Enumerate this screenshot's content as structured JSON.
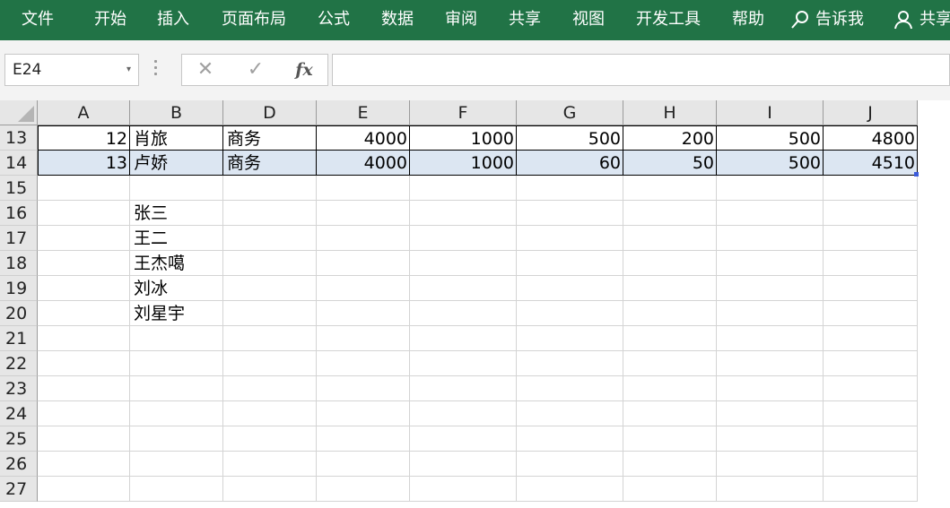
{
  "ribbon": {
    "tabs": [
      "文件",
      "开始",
      "插入",
      "页面布局",
      "公式",
      "数据",
      "审阅",
      "共享",
      "视图",
      "开发工具",
      "帮助"
    ],
    "tell_me": "告诉我",
    "share": "共享"
  },
  "formula_bar": {
    "name_box": "E24",
    "cancel": "✕",
    "enter": "✓",
    "fx": "fx",
    "content": ""
  },
  "columns": [
    "A",
    "B",
    "D",
    "E",
    "F",
    "G",
    "H",
    "I",
    "J"
  ],
  "rows": [
    {
      "num": "13",
      "cells": [
        "12",
        "肖旅",
        "商务",
        "4000",
        "1000",
        "500",
        "200",
        "500",
        "4800"
      ]
    },
    {
      "num": "14",
      "cells": [
        "13",
        "卢娇",
        "商务",
        "4000",
        "1000",
        "60",
        "50",
        "500",
        "4510"
      ]
    },
    {
      "num": "15",
      "cells": [
        "",
        "",
        "",
        "",
        "",
        "",
        "",
        "",
        ""
      ]
    },
    {
      "num": "16",
      "cells": [
        "",
        "张三",
        "",
        "",
        "",
        "",
        "",
        "",
        ""
      ]
    },
    {
      "num": "17",
      "cells": [
        "",
        "王二",
        "",
        "",
        "",
        "",
        "",
        "",
        ""
      ]
    },
    {
      "num": "18",
      "cells": [
        "",
        "王杰噶",
        "",
        "",
        "",
        "",
        "",
        "",
        ""
      ]
    },
    {
      "num": "19",
      "cells": [
        "",
        "刘冰",
        "",
        "",
        "",
        "",
        "",
        "",
        ""
      ]
    },
    {
      "num": "20",
      "cells": [
        "",
        "刘星宇",
        "",
        "",
        "",
        "",
        "",
        "",
        ""
      ]
    },
    {
      "num": "21",
      "cells": [
        "",
        "",
        "",
        "",
        "",
        "",
        "",
        "",
        ""
      ]
    },
    {
      "num": "22",
      "cells": [
        "",
        "",
        "",
        "",
        "",
        "",
        "",
        "",
        ""
      ]
    },
    {
      "num": "23",
      "cells": [
        "",
        "",
        "",
        "",
        "",
        "",
        "",
        "",
        ""
      ]
    },
    {
      "num": "24",
      "cells": [
        "",
        "",
        "",
        "",
        "",
        "",
        "",
        "",
        ""
      ]
    },
    {
      "num": "25",
      "cells": [
        "",
        "",
        "",
        "",
        "",
        "",
        "",
        "",
        ""
      ]
    },
    {
      "num": "26",
      "cells": [
        "",
        "",
        "",
        "",
        "",
        "",
        "",
        "",
        ""
      ]
    },
    {
      "num": "27",
      "cells": [
        "",
        "",
        "",
        "",
        "",
        "",
        "",
        "",
        ""
      ]
    }
  ],
  "colors": {
    "ribbon": "#217346",
    "selection": "#dce6f2"
  }
}
